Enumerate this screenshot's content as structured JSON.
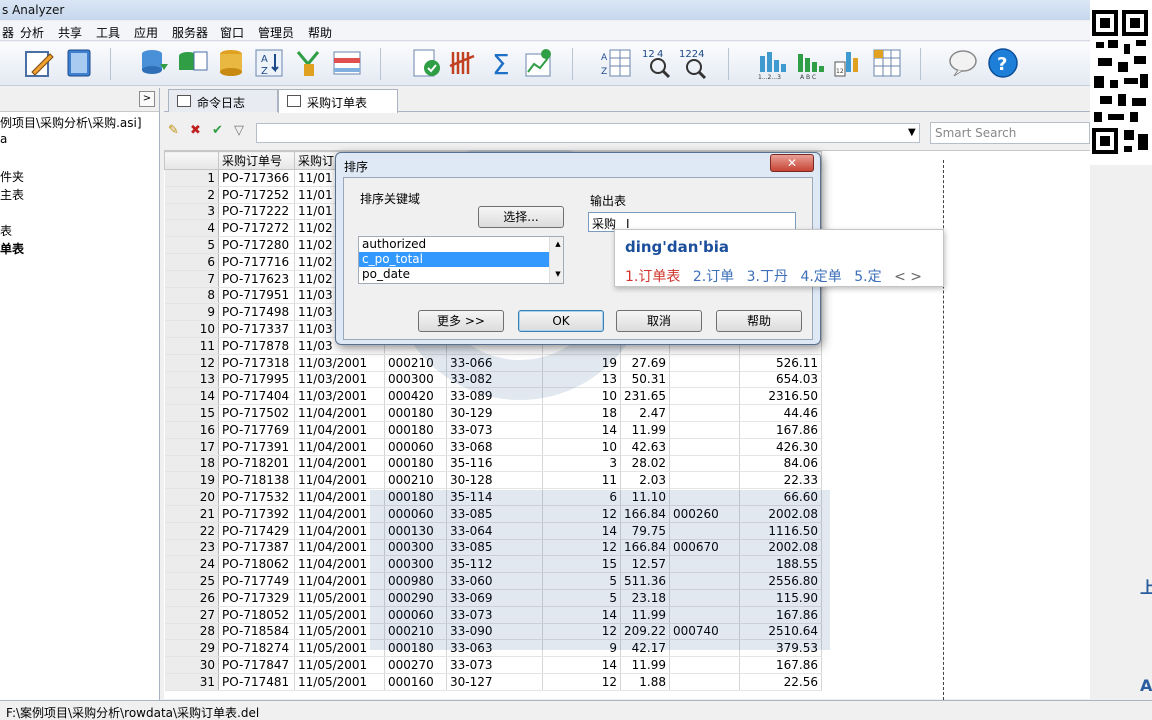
{
  "window": {
    "title": "s Analyzer"
  },
  "menu": [
    "器",
    "分析",
    "共享",
    "工具",
    "应用",
    "服务器",
    "窗口",
    "管理员",
    "帮助"
  ],
  "left_panel": {
    "collapse_label": ">",
    "tree": [
      "例项目\\采购分析\\采购.asi]",
      "a",
      "件夹",
      "主表",
      "表",
      "单表"
    ]
  },
  "tabs": [
    {
      "label": "命令日志"
    },
    {
      "label": "采购订单表",
      "close": "✕"
    }
  ],
  "filter": {
    "smart_search_placeholder": "Smart Search",
    "dropdown": "▼"
  },
  "grid": {
    "columns": [
      "",
      "采购订单号",
      "采购订"
    ],
    "rows": [
      [
        "1",
        "PO-717366",
        "11/01",
        "",
        "",
        "",
        "",
        "",
        ""
      ],
      [
        "2",
        "PO-717252",
        "11/01",
        "",
        "",
        "",
        "",
        "",
        ""
      ],
      [
        "3",
        "PO-717222",
        "11/01",
        "",
        "",
        "",
        "",
        "",
        ""
      ],
      [
        "4",
        "PO-717272",
        "11/02",
        "",
        "",
        "",
        "",
        "",
        ""
      ],
      [
        "5",
        "PO-717280",
        "11/02",
        "",
        "",
        "",
        "",
        "",
        ""
      ],
      [
        "6",
        "PO-717716",
        "11/02",
        "",
        "",
        "",
        "",
        "",
        ""
      ],
      [
        "7",
        "PO-717623",
        "11/02",
        "",
        "",
        "",
        "",
        "",
        ""
      ],
      [
        "8",
        "PO-717951",
        "11/03",
        "",
        "",
        "",
        "",
        "",
        ""
      ],
      [
        "9",
        "PO-717498",
        "11/03",
        "",
        "",
        "",
        "",
        "",
        ""
      ],
      [
        "10",
        "PO-717337",
        "11/03",
        "",
        "",
        "",
        "",
        "",
        ""
      ],
      [
        "11",
        "PO-717878",
        "11/03",
        "",
        "",
        "",
        "",
        "",
        ""
      ],
      [
        "12",
        "PO-717318",
        "11/03/2001",
        "000210",
        "33-066",
        "19",
        "27.69",
        "",
        "526.11"
      ],
      [
        "13",
        "PO-717995",
        "11/03/2001",
        "000300",
        "33-082",
        "13",
        "50.31",
        "",
        "654.03"
      ],
      [
        "14",
        "PO-717404",
        "11/03/2001",
        "000420",
        "33-089",
        "10",
        "231.65",
        "",
        "2316.50"
      ],
      [
        "15",
        "PO-717502",
        "11/04/2001",
        "000180",
        "30-129",
        "18",
        "2.47",
        "",
        "44.46"
      ],
      [
        "16",
        "PO-717769",
        "11/04/2001",
        "000180",
        "33-073",
        "14",
        "11.99",
        "",
        "167.86"
      ],
      [
        "17",
        "PO-717391",
        "11/04/2001",
        "000060",
        "33-068",
        "10",
        "42.63",
        "",
        "426.30"
      ],
      [
        "18",
        "PO-718201",
        "11/04/2001",
        "000180",
        "35-116",
        "3",
        "28.02",
        "",
        "84.06"
      ],
      [
        "19",
        "PO-718138",
        "11/04/2001",
        "000210",
        "30-128",
        "11",
        "2.03",
        "",
        "22.33"
      ],
      [
        "20",
        "PO-717532",
        "11/04/2001",
        "000180",
        "35-114",
        "6",
        "11.10",
        "",
        "66.60"
      ],
      [
        "21",
        "PO-717392",
        "11/04/2001",
        "000060",
        "33-085",
        "12",
        "166.84",
        "000260",
        "2002.08"
      ],
      [
        "22",
        "PO-717429",
        "11/04/2001",
        "000130",
        "33-064",
        "14",
        "79.75",
        "",
        "1116.50"
      ],
      [
        "23",
        "PO-717387",
        "11/04/2001",
        "000300",
        "33-085",
        "12",
        "166.84",
        "000670",
        "2002.08"
      ],
      [
        "24",
        "PO-718062",
        "11/04/2001",
        "000300",
        "35-112",
        "15",
        "12.57",
        "",
        "188.55"
      ],
      [
        "25",
        "PO-717749",
        "11/04/2001",
        "000980",
        "33-060",
        "5",
        "511.36",
        "",
        "2556.80"
      ],
      [
        "26",
        "PO-717329",
        "11/05/2001",
        "000290",
        "33-069",
        "5",
        "23.18",
        "",
        "115.90"
      ],
      [
        "27",
        "PO-718052",
        "11/05/2001",
        "000060",
        "33-073",
        "14",
        "11.99",
        "",
        "167.86"
      ],
      [
        "28",
        "PO-718584",
        "11/05/2001",
        "000210",
        "33-090",
        "12",
        "209.22",
        "000740",
        "2510.64"
      ],
      [
        "29",
        "PO-718274",
        "11/05/2001",
        "000180",
        "33-063",
        "9",
        "42.17",
        "",
        "379.53"
      ],
      [
        "30",
        "PO-717847",
        "11/05/2001",
        "000270",
        "33-073",
        "14",
        "11.99",
        "",
        "167.86"
      ],
      [
        "31",
        "PO-717481",
        "11/05/2001",
        "000160",
        "30-127",
        "12",
        "1.88",
        "",
        "22.56"
      ]
    ]
  },
  "status": {
    "path": "F:\\案例项目\\采购分析\\rowdata\\采购订单表.del"
  },
  "dialog": {
    "title": "排序",
    "close": "✕",
    "sort_key_label": "排序关键域",
    "select_button": "选择...",
    "keys": [
      "authorized",
      "c_po_total",
      "po_date"
    ],
    "selected_key_index": 1,
    "output_label": "输出表",
    "output_value": "采购",
    "more_button": "更多 >>",
    "ok_button": "OK",
    "cancel_button": "取消",
    "help_button": "帮助"
  },
  "ime": {
    "composition": "ding'dan'bia",
    "candidates": [
      "1.订单表",
      "2.订单",
      "3.丁丹",
      "4.定单",
      "5.定"
    ],
    "nav": "< >"
  },
  "edge_glyphs": [
    "上",
    "A"
  ],
  "colors": {
    "selection": "#3399ff",
    "ime_first": "#d0342c",
    "ime_text": "#3d6fb8"
  }
}
